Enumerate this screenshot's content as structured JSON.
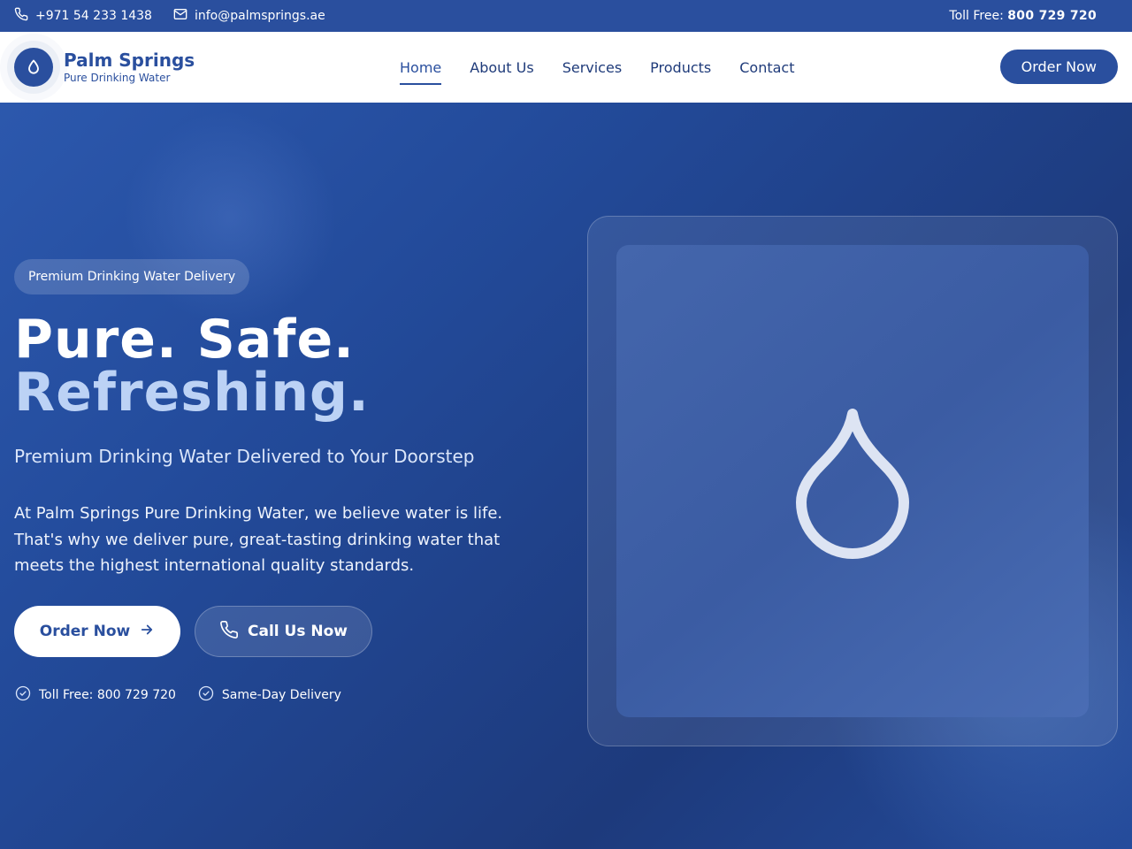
{
  "topbar": {
    "phone": "+971 54 233 1438",
    "email": "info@palmsprings.ae",
    "toll_free_label": "Toll Free:",
    "toll_free_number": "800 729 720"
  },
  "header": {
    "brand_name": "Palm Springs",
    "brand_tagline": "Pure Drinking Water",
    "nav": [
      {
        "label": "Home",
        "active": true
      },
      {
        "label": "About Us"
      },
      {
        "label": "Services"
      },
      {
        "label": "Products"
      },
      {
        "label": "Contact"
      }
    ],
    "order_button": "Order Now"
  },
  "hero": {
    "badge": "Premium Drinking Water Delivery",
    "title_line1": "Pure. Safe.",
    "title_line2": "Refreshing.",
    "subtitle": "Premium Drinking Water Delivered to Your Doorstep",
    "description": "At Palm Springs Pure Drinking Water, we believe water is life. That's why we deliver pure, great-tasting drinking water that meets the highest international quality standards.",
    "primary_button": "Order Now",
    "secondary_button": "Call Us Now",
    "features": [
      "Toll Free: 800 729 720",
      "Same-Day Delivery"
    ]
  },
  "icons": {
    "phone": "phone-icon",
    "email": "mail-icon",
    "logo": "water-drop-icon",
    "arrow": "arrow-right-icon",
    "check": "check-circle-icon",
    "card": "water-drop-outline-icon"
  },
  "colors": {
    "brand": "#2a4f9e",
    "hero_bg": "#1e3f86",
    "accent_text": "#bcd2f5"
  }
}
